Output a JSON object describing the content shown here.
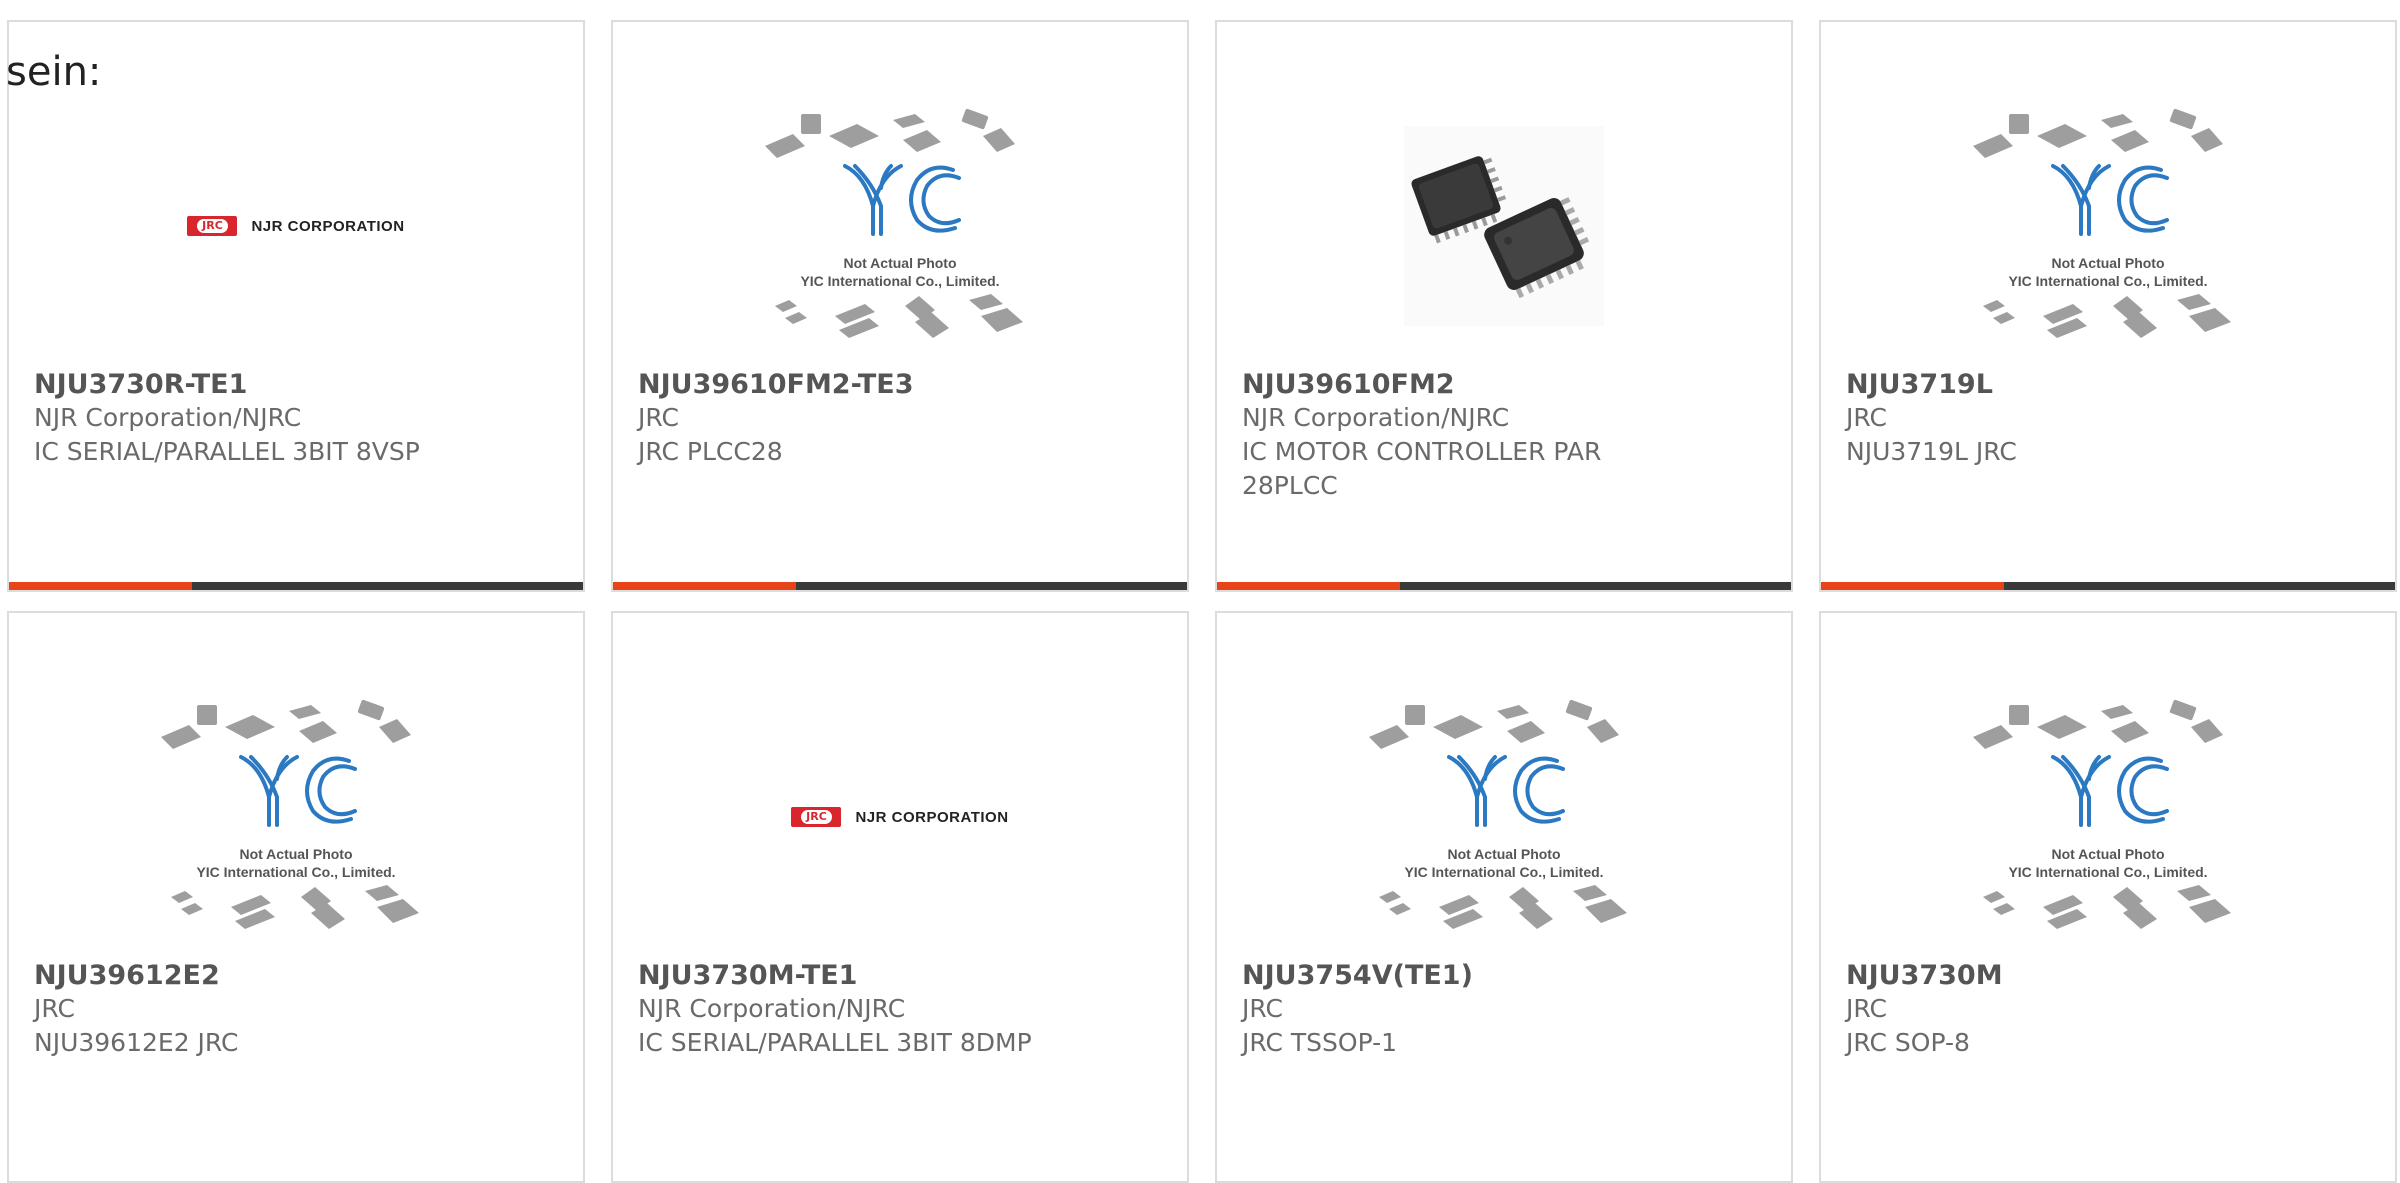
{
  "intro_text": "sein:",
  "placeholder": {
    "line1": "Not Actual Photo",
    "line2": "YIC International Co., Limited.",
    "logo": "YIC"
  },
  "jrc_logo": {
    "mark": "JRC",
    "text": "NJR CORPORATION"
  },
  "colors": {
    "accent": "#e8441a",
    "bar": "#3a3a3a",
    "border": "#dcdcdc",
    "yic_blue": "#2b79c2"
  },
  "products": [
    {
      "part": "NJU3730R-TE1",
      "manufacturer": "NJR Corporation/NJRC",
      "description": "IC SERIAL/PARALLEL 3BIT 8VSP",
      "image": "njr-logo"
    },
    {
      "part": "NJU39610FM2-TE3",
      "manufacturer": "JRC",
      "description": "JRC PLCC28",
      "image": "yic-placeholder"
    },
    {
      "part": "NJU39610FM2",
      "manufacturer": "NJR Corporation/NJRC",
      "description": "IC MOTOR CONTROLLER PAR 28PLCC",
      "image": "chip-photo"
    },
    {
      "part": "NJU3719L",
      "manufacturer": "JRC",
      "description": "NJU3719L JRC",
      "image": "yic-placeholder"
    },
    {
      "part": "NJU39612E2",
      "manufacturer": "JRC",
      "description": "NJU39612E2 JRC",
      "image": "yic-placeholder"
    },
    {
      "part": "NJU3730M-TE1",
      "manufacturer": "NJR Corporation/NJRC",
      "description": "IC SERIAL/PARALLEL 3BIT 8DMP",
      "image": "njr-logo"
    },
    {
      "part": "NJU3754V(TE1)",
      "manufacturer": "JRC",
      "description": "JRC TSSOP-1",
      "image": "yic-placeholder"
    },
    {
      "part": "NJU3730M",
      "manufacturer": "JRC",
      "description": "JRC SOP-8",
      "image": "yic-placeholder"
    }
  ]
}
